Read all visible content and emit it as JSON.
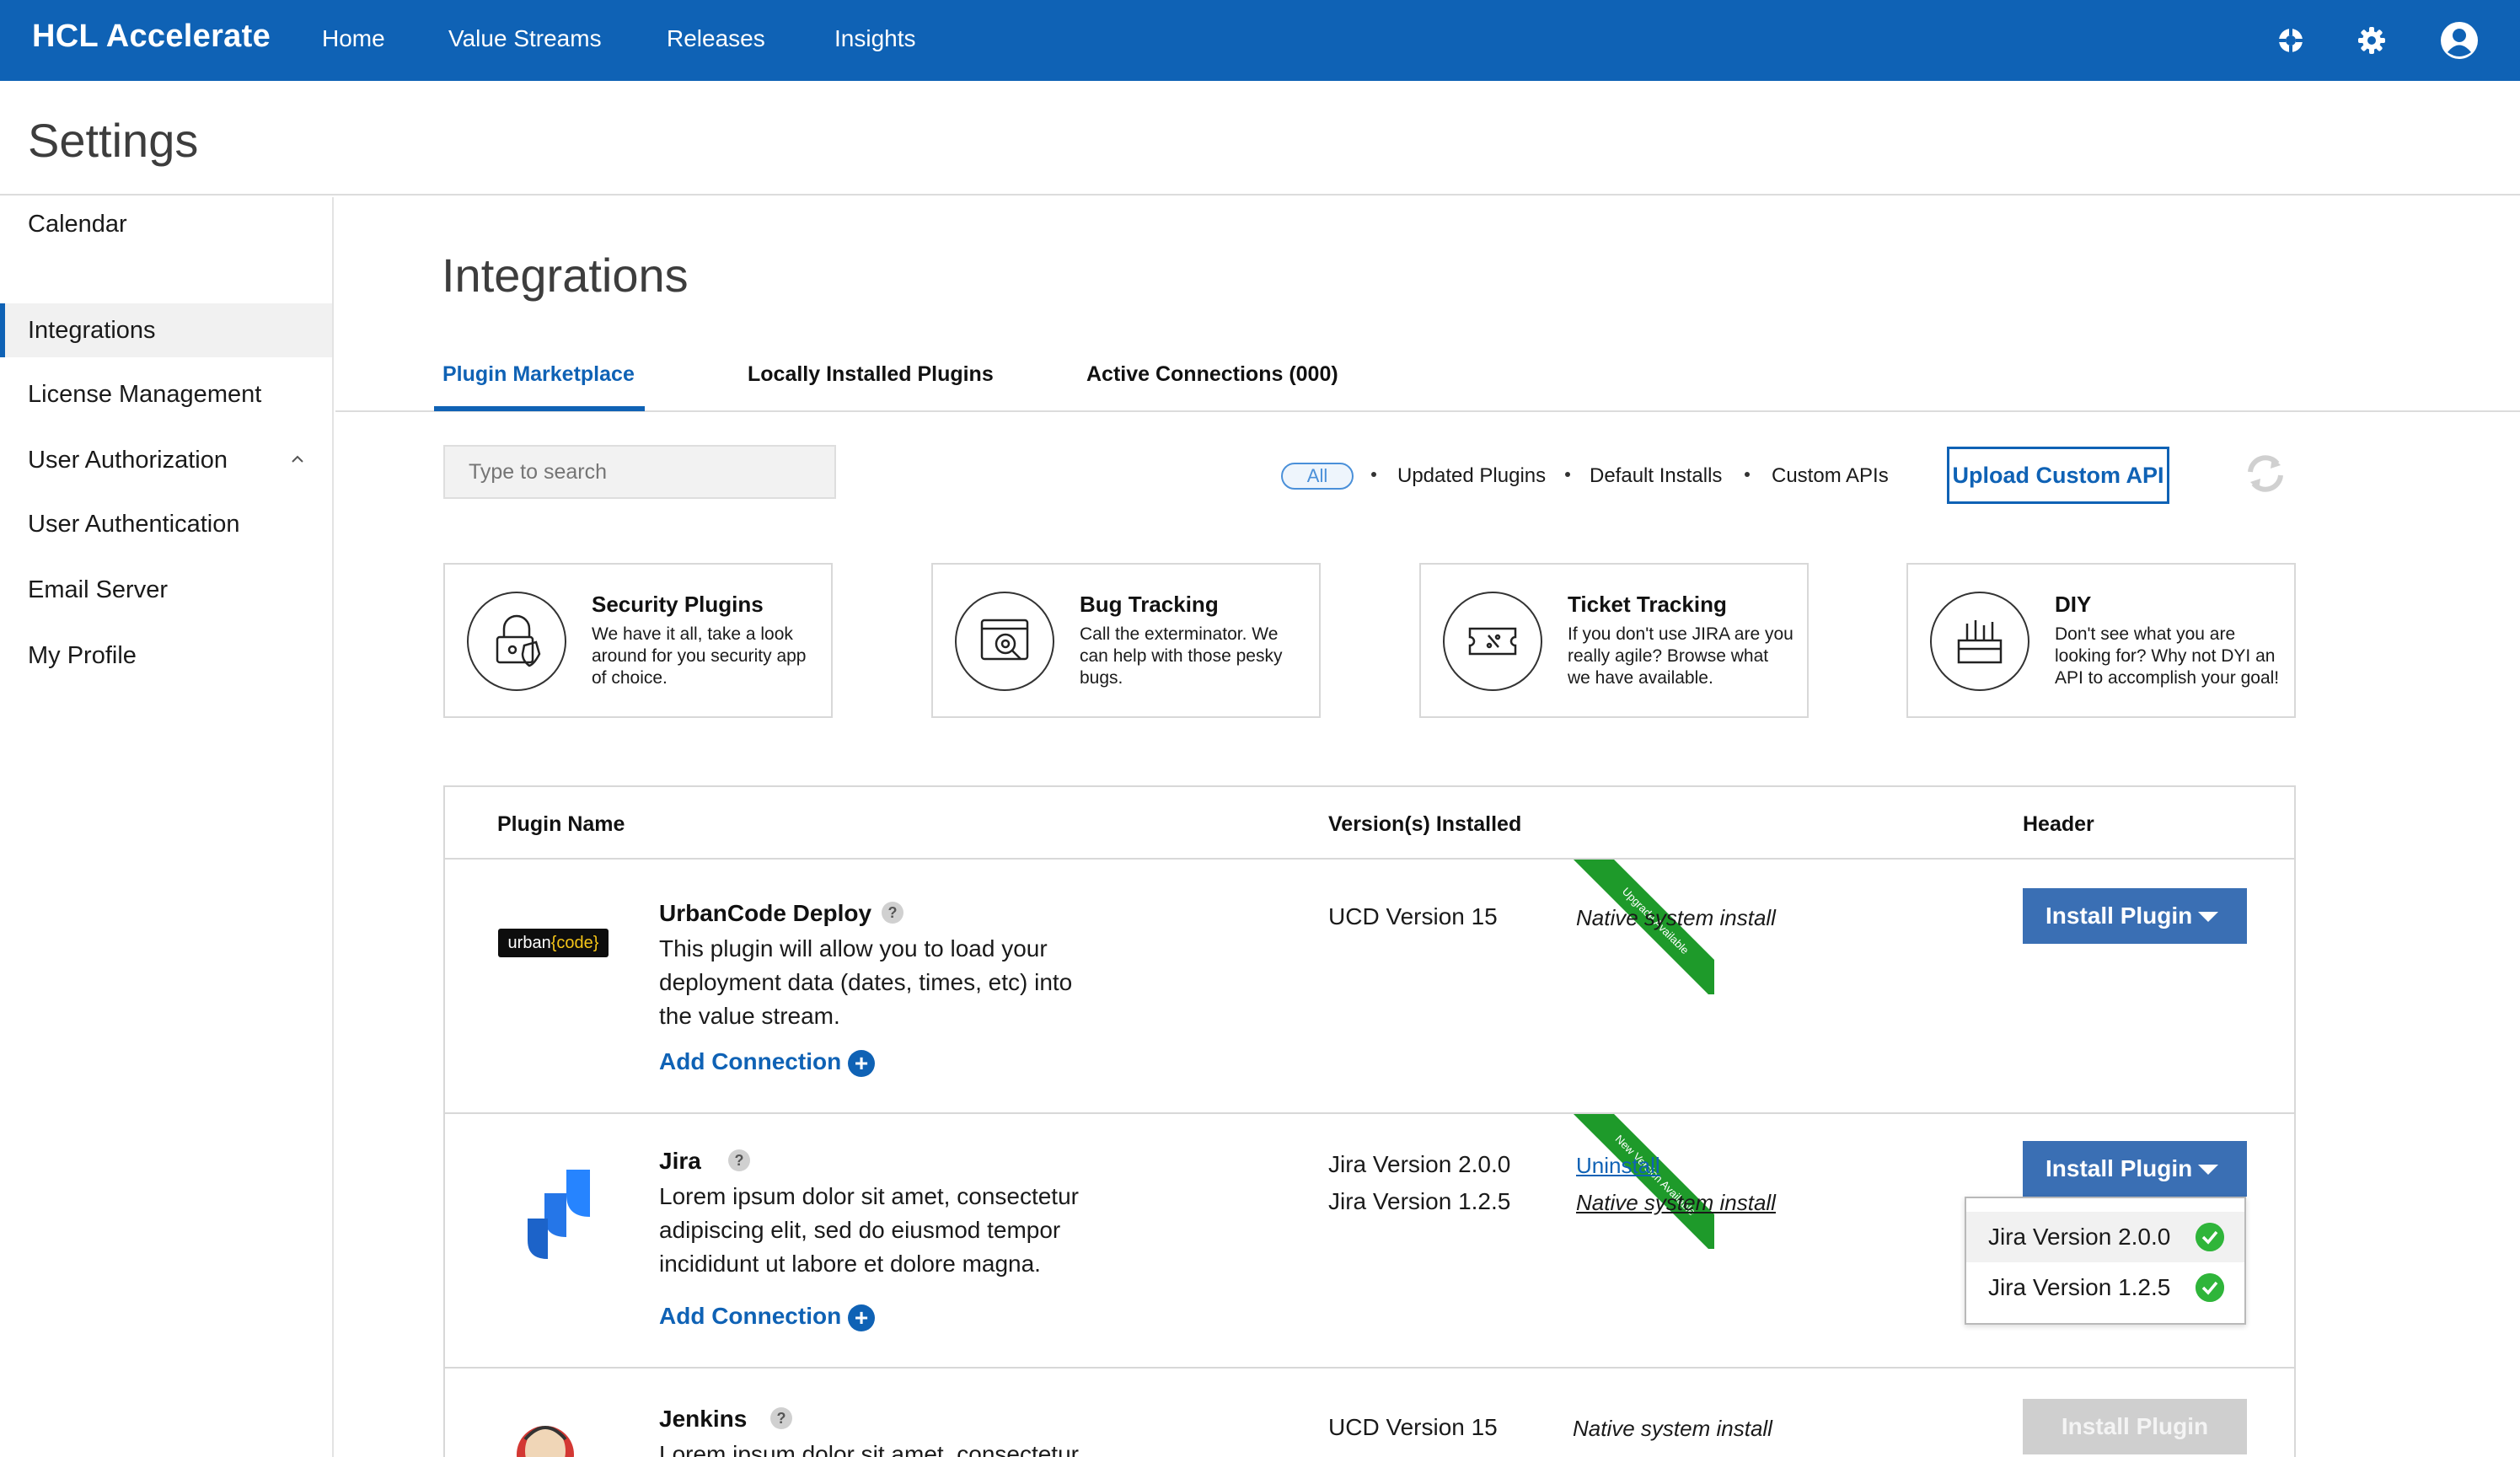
{
  "app": {
    "brand": "HCL Accelerate"
  },
  "topnav": {
    "items": [
      "Home",
      "Value Streams",
      "Releases",
      "Insights"
    ]
  },
  "topicons": [
    "help-icon",
    "settings-gear-icon",
    "user-profile-icon"
  ],
  "settings": {
    "title": "Settings"
  },
  "sidebar": {
    "items": [
      {
        "label": "Calendar"
      },
      {
        "label": "Integrations",
        "active": true
      },
      {
        "label": "License Management"
      },
      {
        "label": "User Authorization",
        "expandable": true
      },
      {
        "label": "User Authentication"
      },
      {
        "label": "Email Server"
      },
      {
        "label": "My Profile"
      }
    ]
  },
  "main": {
    "title": "Integrations",
    "tabs": [
      {
        "label": "Plugin Marketplace",
        "active": true
      },
      {
        "label": "Locally Installed Plugins"
      },
      {
        "label": "Active Connections (000)"
      }
    ],
    "search": {
      "placeholder": "Type to search"
    },
    "filters": {
      "all": "All",
      "items": [
        "Updated Plugins",
        "Default Installs",
        "Custom APIs"
      ]
    },
    "upload_label": "Upload Custom API",
    "cards": [
      {
        "title": "Security Plugins",
        "desc": "We have it all, take a look around for you security app of choice.",
        "icon": "security-lock-icon"
      },
      {
        "title": "Bug Tracking",
        "desc": "Call the exterminator. We can help with those pesky bugs.",
        "icon": "bug-search-icon"
      },
      {
        "title": "Ticket Tracking",
        "desc": "If you don't use JIRA are you really agile? Browse what we have available.",
        "icon": "ticket-icon"
      },
      {
        "title": "DIY",
        "desc": "Don't see what you are looking for? Why not DYI an API to accomplish your goal!",
        "icon": "toolbox-icon"
      }
    ],
    "table": {
      "headers": {
        "name": "Plugin Name",
        "versions": "Version(s) Installed",
        "header": "Header"
      },
      "rows": [
        {
          "name": "UrbanCode Deploy",
          "help": "?",
          "logo_text_a": "urban",
          "logo_text_b": "{code}",
          "desc": "This plugin will allow you to load your deployment data (dates, times, etc) into the value stream.",
          "add_connection": "Add Connection",
          "ribbon": "Upgrade Available",
          "versions": [
            "UCD Version 15"
          ],
          "notes": [
            "Native system install"
          ],
          "button": "Install Plugin"
        },
        {
          "name": "Jira",
          "help": "?",
          "desc": "Lorem ipsum dolor sit amet, consectetur adipiscing elit, sed do eiusmod tempor incididunt ut labore et dolore magna.",
          "add_connection": "Add Connection",
          "ribbon": "New Version Available",
          "versions": [
            "Jira Version 2.0.0",
            "Jira Version 1.2.5"
          ],
          "uninstall": "Uninstall",
          "notes": [
            "Native system install"
          ],
          "button": "Install Plugin",
          "dropdown": [
            "Jira Version 2.0.0",
            "Jira Version 1.2.5"
          ]
        },
        {
          "name": "Jenkins",
          "help": "?",
          "desc": "Lorem ipsum dolor sit amet, consectetur",
          "versions": [
            "UCD Version 15"
          ],
          "notes": [
            "Native system install"
          ],
          "button": "Install Plugin"
        }
      ]
    }
  },
  "colors": {
    "primary": "#0f62b5",
    "button": "#3a6fb4",
    "ribbon": "#1e9a2a",
    "check": "#2fb53a"
  }
}
